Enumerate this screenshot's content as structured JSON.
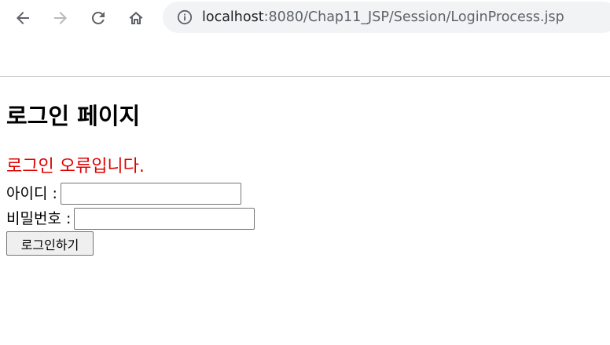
{
  "browser": {
    "url_host": "localhost",
    "url_rest": ":8080/Chap11_JSP/Session/LoginProcess.jsp"
  },
  "page": {
    "title": "로그인 페이지",
    "error_message": "로그인 오류입니다.",
    "id_label": "아이디 :",
    "id_value": "",
    "password_label": "비밀번호 :",
    "password_value": "",
    "login_button": "로그인하기"
  },
  "colors": {
    "error": "#e00000",
    "omnibox_bg": "#f1f3f4"
  }
}
